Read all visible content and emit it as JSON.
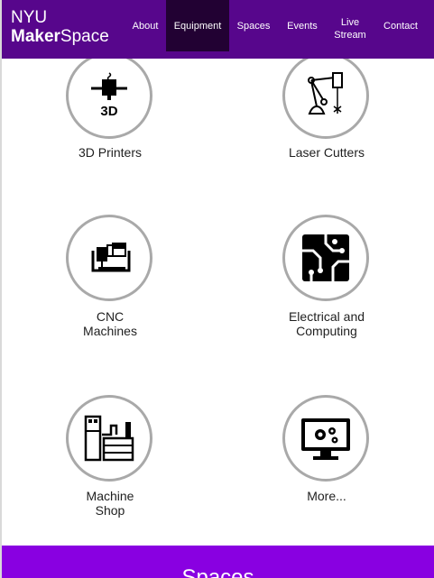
{
  "brand": {
    "line1": "NYU",
    "maker": "Maker",
    "space": "Space"
  },
  "nav": {
    "about": "About",
    "equipment": "Equipment",
    "spaces": "Spaces",
    "events": "Events",
    "live_line1": "Live",
    "live_line2": "Stream",
    "contact": "Contact",
    "active": "Equipment"
  },
  "equipment": [
    {
      "line1": "3D Printers",
      "line2": "",
      "icon": "3d-printer-icon"
    },
    {
      "line1": "Laser Cutters",
      "line2": "",
      "icon": "laser-cutter-icon"
    },
    {
      "line1": "CNC",
      "line2": "Machines",
      "icon": "cnc-machine-icon"
    },
    {
      "line1": "Electrical and",
      "line2": "Computing",
      "icon": "circuit-board-icon"
    },
    {
      "line1": "Machine",
      "line2": "Shop",
      "icon": "machine-shop-icon"
    },
    {
      "line1": "More...",
      "line2": "",
      "icon": "monitor-gears-icon"
    }
  ],
  "footer": {
    "heading": "Spaces"
  },
  "colors": {
    "brand_purple": "#57068c",
    "active_nav": "#220133",
    "footer_purple": "#8900e1",
    "circle_border": "#a9a9a9"
  }
}
